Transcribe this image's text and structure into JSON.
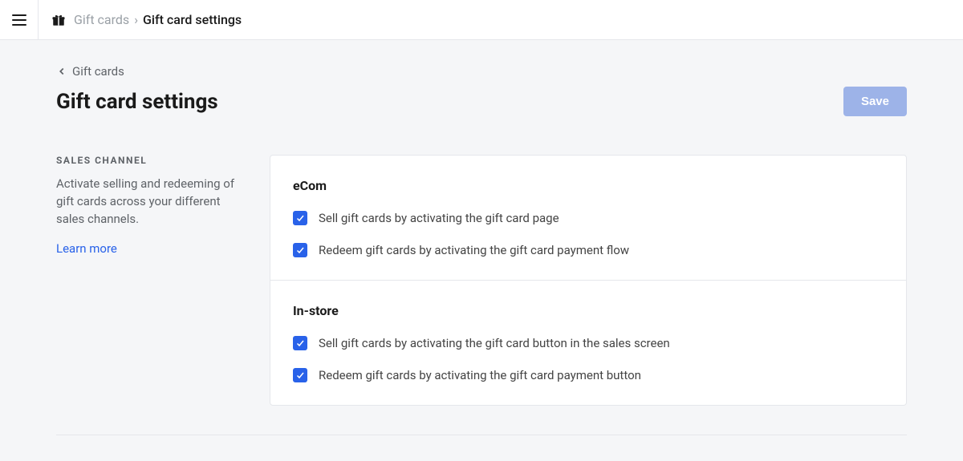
{
  "breadcrumb": {
    "root": "Gift cards",
    "current": "Gift card settings"
  },
  "back_link": "Gift cards",
  "page_title": "Gift card settings",
  "save_label": "Save",
  "section": {
    "label": "Sales Channel",
    "description": "Activate selling and redeeming of gift cards across your different sales channels.",
    "learn_more": "Learn more"
  },
  "panels": {
    "ecom": {
      "title": "eCom",
      "sell_label": "Sell gift cards by activating the gift card page",
      "redeem_label": "Redeem gift cards by activating the gift card payment flow"
    },
    "instore": {
      "title": "In-store",
      "sell_label": "Sell gift cards by activating the gift card button in the sales screen",
      "redeem_label": "Redeem gift cards by activating the gift card payment button"
    }
  }
}
